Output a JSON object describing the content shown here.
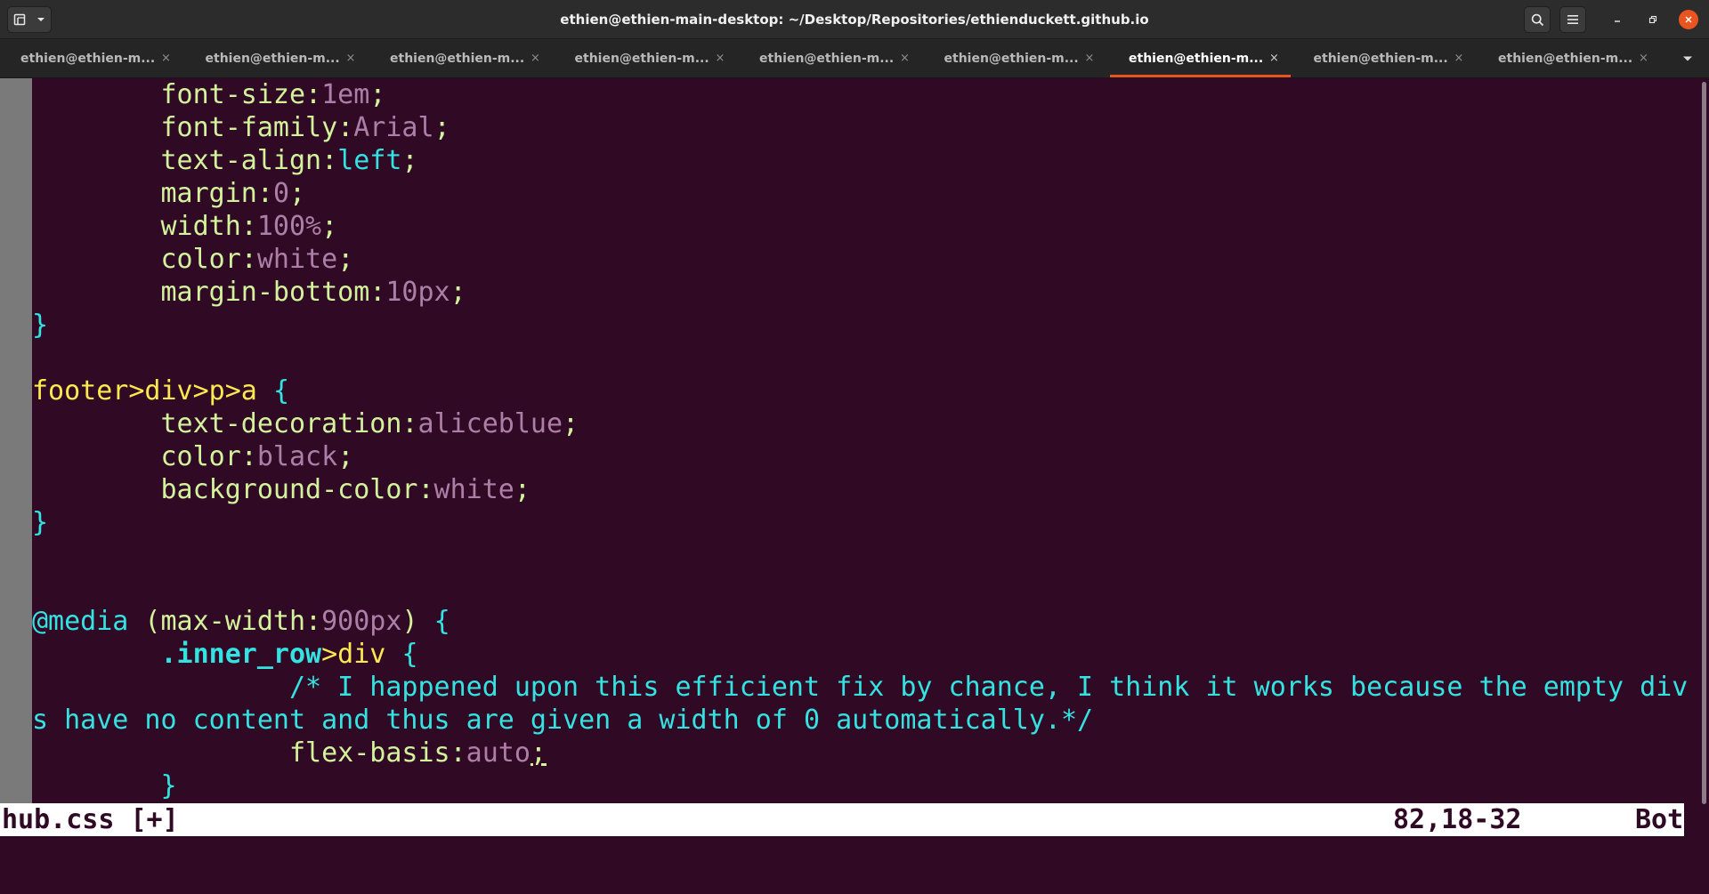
{
  "window": {
    "title": "ethien@ethien-main-desktop: ~/Desktop/Repositories/ethienduckett.github.io",
    "new_tab_icon": "new-tab-icon",
    "search_icon": "search-icon",
    "menu_icon": "hamburger-menu-icon",
    "minimize_icon": "minimize-icon",
    "maximize_icon": "maximize-icon",
    "close_icon": "close-icon",
    "close_color": "#e95420"
  },
  "tabs": [
    {
      "label": "ethien@ethien-m...",
      "active": false
    },
    {
      "label": "ethien@ethien-m...",
      "active": false
    },
    {
      "label": "ethien@ethien-m...",
      "active": false
    },
    {
      "label": "ethien@ethien-m...",
      "active": false
    },
    {
      "label": "ethien@ethien-m...",
      "active": false
    },
    {
      "label": "ethien@ethien-m...",
      "active": false
    },
    {
      "label": "ethien@ethien-m...",
      "active": true
    },
    {
      "label": "ethien@ethien-m...",
      "active": false
    },
    {
      "label": "ethien@ethien-m...",
      "active": false
    }
  ],
  "tab_close_glyph": "×",
  "terminal": {
    "background": "#300a24",
    "lines": [
      [
        {
          "t": "        "
        },
        {
          "t": "font-size:",
          "k": "p"
        },
        {
          "t": "1em",
          "k": "v"
        },
        {
          "t": ";",
          "k": "p"
        }
      ],
      [
        {
          "t": "        "
        },
        {
          "t": "font-family:",
          "k": "p"
        },
        {
          "t": "Arial",
          "k": "v"
        },
        {
          "t": ";",
          "k": "p"
        }
      ],
      [
        {
          "t": "        "
        },
        {
          "t": "text-align:",
          "k": "p"
        },
        {
          "t": "left",
          "k": "c"
        },
        {
          "t": ";",
          "k": "p"
        }
      ],
      [
        {
          "t": "        "
        },
        {
          "t": "margin:",
          "k": "p"
        },
        {
          "t": "0",
          "k": "v"
        },
        {
          "t": ";",
          "k": "p"
        }
      ],
      [
        {
          "t": "        "
        },
        {
          "t": "width:",
          "k": "p"
        },
        {
          "t": "100%",
          "k": "v"
        },
        {
          "t": ";",
          "k": "p"
        }
      ],
      [
        {
          "t": "        "
        },
        {
          "t": "color:",
          "k": "p"
        },
        {
          "t": "white",
          "k": "v"
        },
        {
          "t": ";",
          "k": "p"
        }
      ],
      [
        {
          "t": "        "
        },
        {
          "t": "margin-bottom:",
          "k": "p"
        },
        {
          "t": "10px",
          "k": "v"
        },
        {
          "t": ";",
          "k": "p"
        }
      ],
      [
        {
          "t": "}",
          "k": "b"
        }
      ],
      [],
      [
        {
          "t": "footer>div>p>a ",
          "k": "s"
        },
        {
          "t": "{",
          "k": "b"
        }
      ],
      [
        {
          "t": "        "
        },
        {
          "t": "text-decoration:",
          "k": "p"
        },
        {
          "t": "aliceblue",
          "k": "v"
        },
        {
          "t": ";",
          "k": "p"
        }
      ],
      [
        {
          "t": "        "
        },
        {
          "t": "color:",
          "k": "p"
        },
        {
          "t": "black",
          "k": "v"
        },
        {
          "t": ";",
          "k": "p"
        }
      ],
      [
        {
          "t": "        "
        },
        {
          "t": "background-color:",
          "k": "p"
        },
        {
          "t": "white",
          "k": "v"
        },
        {
          "t": ";",
          "k": "p"
        }
      ],
      [
        {
          "t": "}",
          "k": "b"
        }
      ],
      [],
      [],
      [
        {
          "t": "@media",
          "k": "c"
        },
        {
          "t": " (max-width:",
          "k": "p"
        },
        {
          "t": "900px",
          "k": "v"
        },
        {
          "t": ") ",
          "k": "p"
        },
        {
          "t": "{",
          "k": "b"
        }
      ],
      [
        {
          "t": "        "
        },
        {
          "t": ".inner_row",
          "k": "cl"
        },
        {
          "t": ">div ",
          "k": "s"
        },
        {
          "t": "{",
          "k": "b"
        }
      ],
      [
        {
          "t": "                "
        },
        {
          "t": "/* I happened upon this efficient fix by chance, I think it works because the empty div",
          "k": "c"
        }
      ],
      [
        {
          "t": "s have no content and thus are given a width of 0 automatically.*/",
          "k": "c"
        }
      ],
      [
        {
          "t": "                "
        },
        {
          "t": "flex-basis:",
          "k": "p"
        },
        {
          "t": "auto",
          "k": "v"
        },
        {
          "t": ";",
          "k": "cur"
        }
      ],
      [
        {
          "t": "        "
        },
        {
          "t": "}",
          "k": "b"
        }
      ]
    ]
  },
  "statusline": {
    "filename": "hub.css [+]",
    "position": "82,18-32",
    "scroll": "Bot"
  }
}
